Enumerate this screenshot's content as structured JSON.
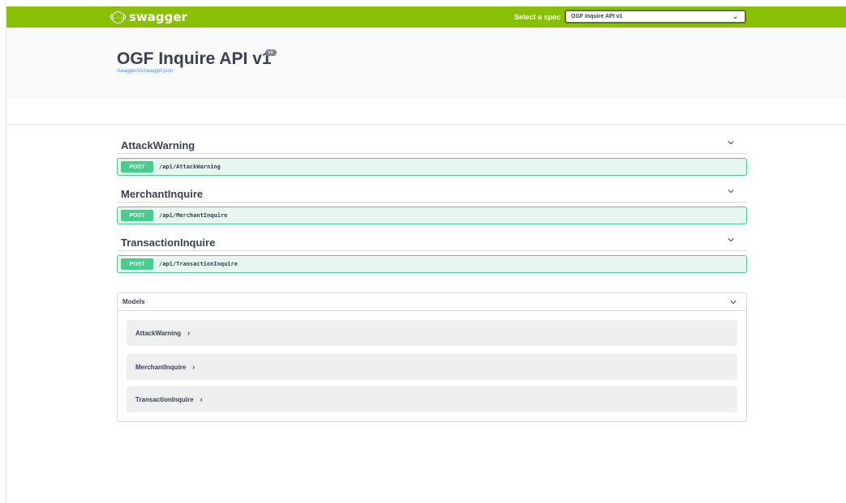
{
  "topbar": {
    "logo_text": "swagger",
    "logo_glyph": "{...}",
    "spec_label": "Select a spec",
    "spec_selected": "OGF Inquire API v1"
  },
  "info": {
    "title": "OGF Inquire API v1",
    "version": "v1",
    "spec_url": "/swagger/v1/swagger.json"
  },
  "operations": [
    {
      "tag": "AttackWarning",
      "method": "POST",
      "path": "/api/AttackWarning"
    },
    {
      "tag": "MerchantInquire",
      "method": "POST",
      "path": "/api/MerchantInquire"
    },
    {
      "tag": "TransactionInquire",
      "method": "POST",
      "path": "/api/TransactionInquire"
    }
  ],
  "models": {
    "title": "Models",
    "items": [
      "AttackWarning",
      "MerchantInquire",
      "TransactionInquire"
    ],
    "arrow": "›"
  },
  "colors": {
    "topbar": "#89bf04",
    "post_method": "#49cc90",
    "post_bg": "#e8f6f0",
    "text": "#3b4151",
    "link": "#4990e2"
  }
}
